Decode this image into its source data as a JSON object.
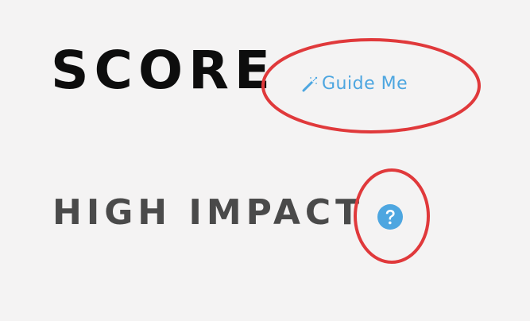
{
  "score": {
    "title": "SCORE",
    "guide_label": "Guide Me",
    "guide_icon": "magic-wand-icon"
  },
  "impact": {
    "title": "HIGH IMPACT",
    "help_icon": "question-circle-icon"
  },
  "colors": {
    "background": "#f4f3f3",
    "score_text": "#0d0d0d",
    "impact_text": "#4a4a4a",
    "link_blue": "#4da6e0",
    "annotation_red": "#e0393b"
  }
}
